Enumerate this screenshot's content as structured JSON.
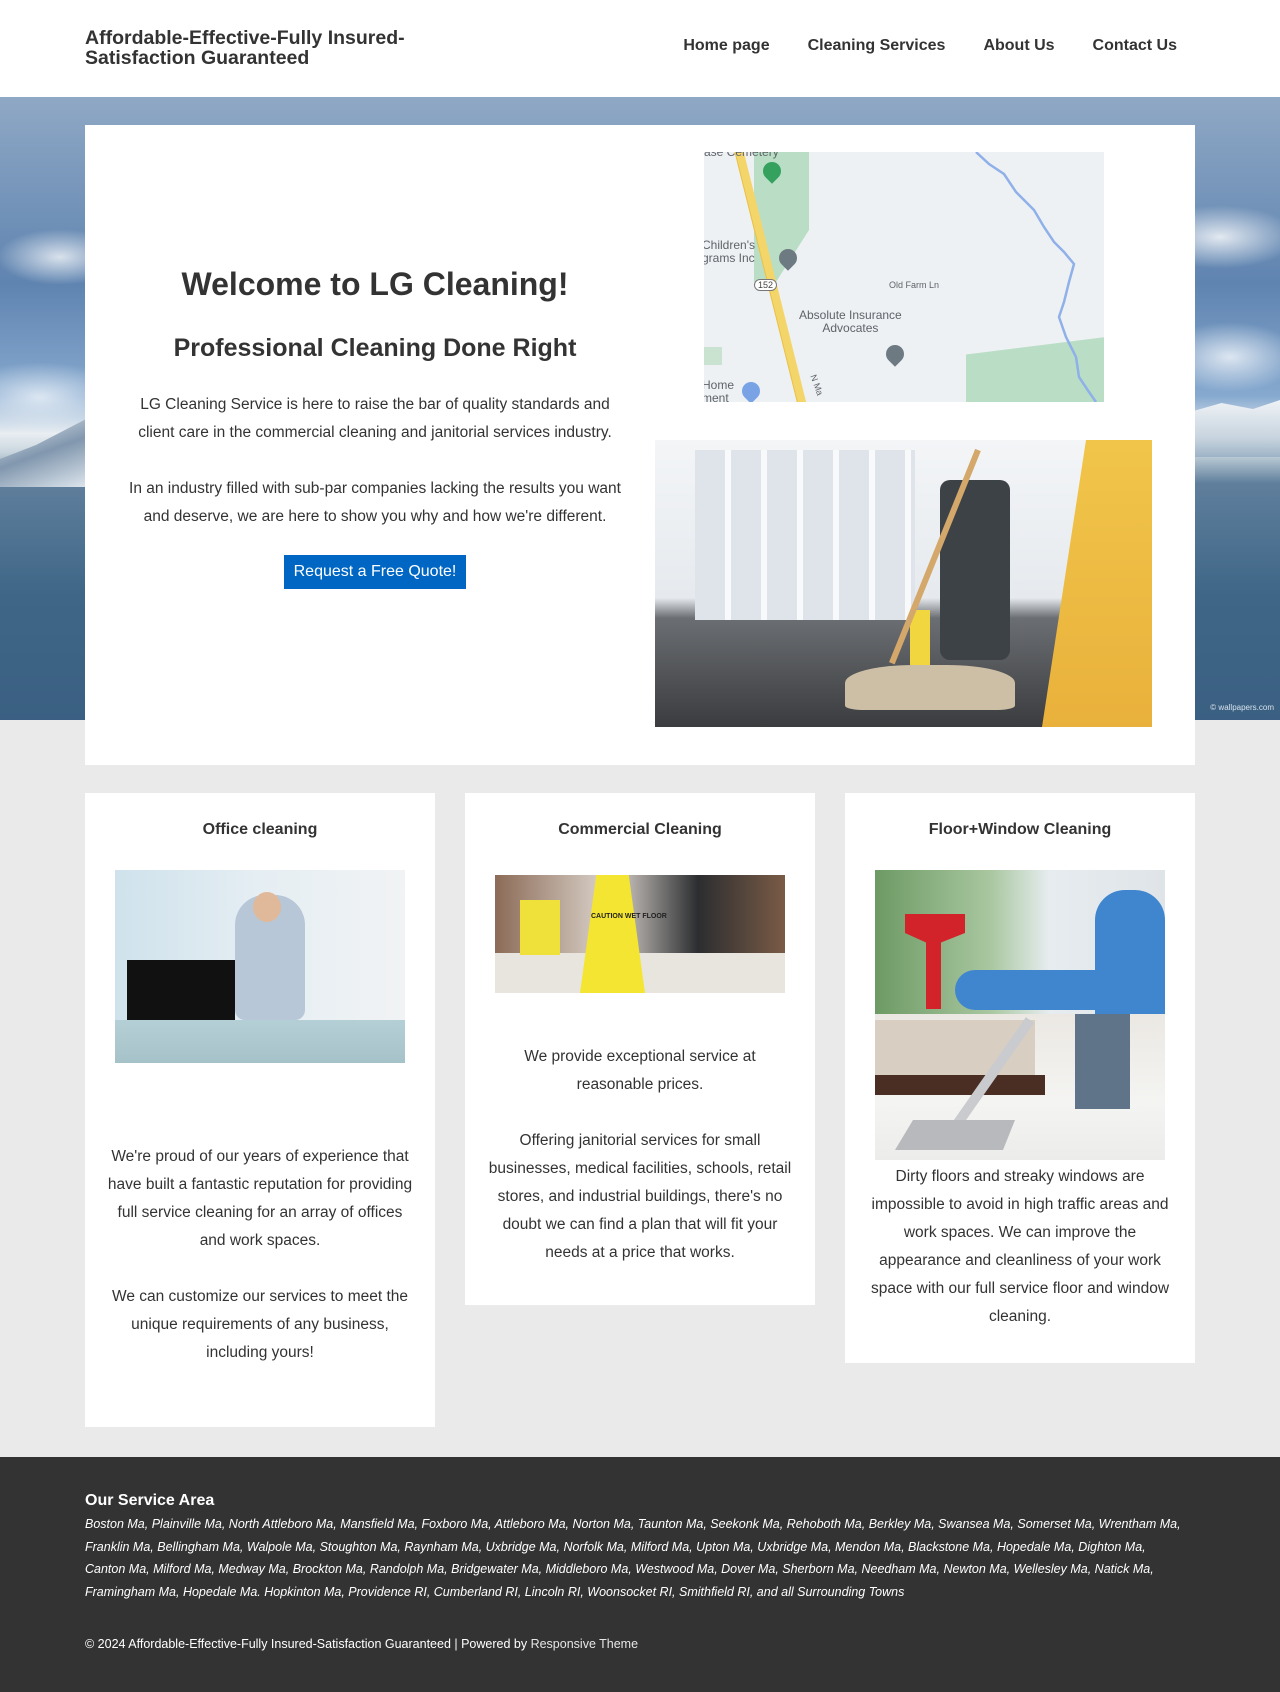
{
  "header": {
    "site_title": "Affordable-Effective-Fully Insured-Satisfaction Guaranteed",
    "nav": [
      {
        "label": "Home page"
      },
      {
        "label": "Cleaning Services"
      },
      {
        "label": "About Us"
      },
      {
        "label": "Contact Us"
      }
    ]
  },
  "hero": {
    "title": "Welcome to LG Cleaning!",
    "subtitle": "Professional Cleaning Done Right",
    "paragraphs": [
      "LG Cleaning Service is here to raise the bar of quality standards and client care in the commercial cleaning and janitorial services industry.",
      "In an industry filled with sub-par companies lacking the results you want and deserve, we are here to show you why and how we're different."
    ],
    "cta_label": "Request a Free Quote!",
    "background_watermark": "© wallpapers.com",
    "map": {
      "labels": {
        "cemetery": "ase Cemetery",
        "childrens": "Children's\ngrams Inc",
        "route": "152",
        "road": "Old Farm Ln",
        "business": "Absolute Insurance\nAdvocates",
        "home": "Home\nment",
        "street": "N Ma"
      }
    },
    "image_alt": "Janitor mopping floor near caution sign"
  },
  "services": [
    {
      "title": "Office cleaning",
      "image_alt": "Woman cleaning office desk",
      "paragraphs": [
        "We're proud of our years of experience that have built a fantastic reputation for providing full service cleaning for an array of offices and work spaces.",
        "We can customize our services to meet the unique requirements of any business, including yours!"
      ]
    },
    {
      "title": "Commercial Cleaning",
      "image_alt": "Wet floor caution sign in commercial building",
      "image_sign_text": "CAUTION WET FLOOR",
      "paragraphs": [
        "We  provide exceptional service at reasonable prices.",
        "Offering janitorial services for small businesses, medical facilities, schools, retail stores, and industrial buildings, there's no doubt we can find a plan that will fit your needs at a price that works."
      ]
    },
    {
      "title": "Floor+Window Cleaning",
      "image_alt": "Window squeegee and vacuum cleaning",
      "paragraphs": [
        "Dirty floors and streaky windows are impossible to avoid in high traffic areas and work spaces. We can improve the appearance and cleanliness of your work space with our full service floor and window cleaning."
      ]
    }
  ],
  "footer": {
    "service_area_title": "Our Service Area",
    "service_areas": "Boston Ma, Plainville Ma, North Attleboro Ma, Mansfield Ma, Foxboro Ma, Attleboro Ma, Norton Ma, Taunton Ma, Seekonk Ma, Rehoboth Ma, Berkley Ma, Swansea Ma, Somerset Ma, Wrentham Ma, Franklin Ma, Bellingham Ma, Walpole Ma, Stoughton Ma, Raynham Ma, Uxbridge Ma, Norfolk Ma, Milford Ma, Upton Ma, Uxbridge Ma, Mendon Ma, Blackstone Ma, Hopedale Ma, Dighton Ma, Canton Ma, Milford Ma, Medway Ma, Brockton Ma, Randolph Ma, Bridgewater Ma, Middleboro Ma, Westwood Ma, Dover Ma, Sherborn Ma, Needham Ma, Newton Ma, Wellesley Ma, Natick Ma, Framingham Ma, Hopedale Ma. Hopkinton Ma, Providence RI, Cumberland RI, Lincoln RI, Woonsocket RI, Smithfield RI, and all Surrounding Towns",
    "copyright": "© 2024 Affordable-Effective-Fully Insured-Satisfaction Guaranteed | Powered by ",
    "theme_link": "Responsive Theme"
  },
  "colors": {
    "accent": "#0066c4",
    "text": "#333333",
    "footer_bg": "#333333",
    "page_bg": "#eaeaea"
  }
}
